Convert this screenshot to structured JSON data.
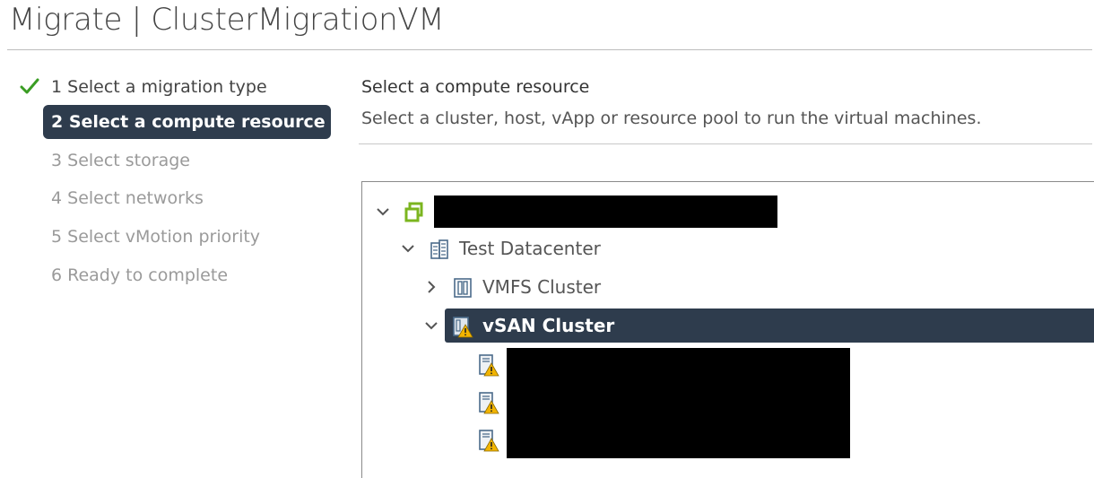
{
  "window": {
    "title": "Migrate | ClusterMigrationVM"
  },
  "steps": [
    {
      "label": "1 Select a migration type",
      "status": "completed"
    },
    {
      "label": "2 Select a compute resource",
      "status": "active"
    },
    {
      "label": "3 Select storage",
      "status": "pending"
    },
    {
      "label": "4 Select networks",
      "status": "pending"
    },
    {
      "label": "5 Select vMotion priority",
      "status": "pending"
    },
    {
      "label": "6 Ready to complete",
      "status": "pending"
    }
  ],
  "content": {
    "heading": "Select a compute resource",
    "description": "Select a cluster, host, vApp or resource pool to run the virtual machines."
  },
  "tree": {
    "vcenter": {
      "label": "",
      "icon": "vcenter-icon",
      "expanded": true
    },
    "datacenter": {
      "label": "Test Datacenter",
      "icon": "datacenter-icon",
      "expanded": true
    },
    "clusters": [
      {
        "label": "VMFS Cluster",
        "icon": "cluster-icon",
        "expanded": false,
        "selected": false
      },
      {
        "label": "vSAN Cluster",
        "icon": "cluster-warning-icon",
        "expanded": true,
        "selected": true
      }
    ],
    "hosts": [
      {
        "label": "",
        "icon": "host-warning-icon"
      },
      {
        "label": "",
        "icon": "host-warning-icon"
      },
      {
        "label": "",
        "icon": "host-warning-icon"
      }
    ]
  },
  "colors": {
    "selected_bg": "#2e3c4d",
    "check": "#3a9d23",
    "warning": "#f2b400",
    "vcenter": "#7bb51f"
  }
}
